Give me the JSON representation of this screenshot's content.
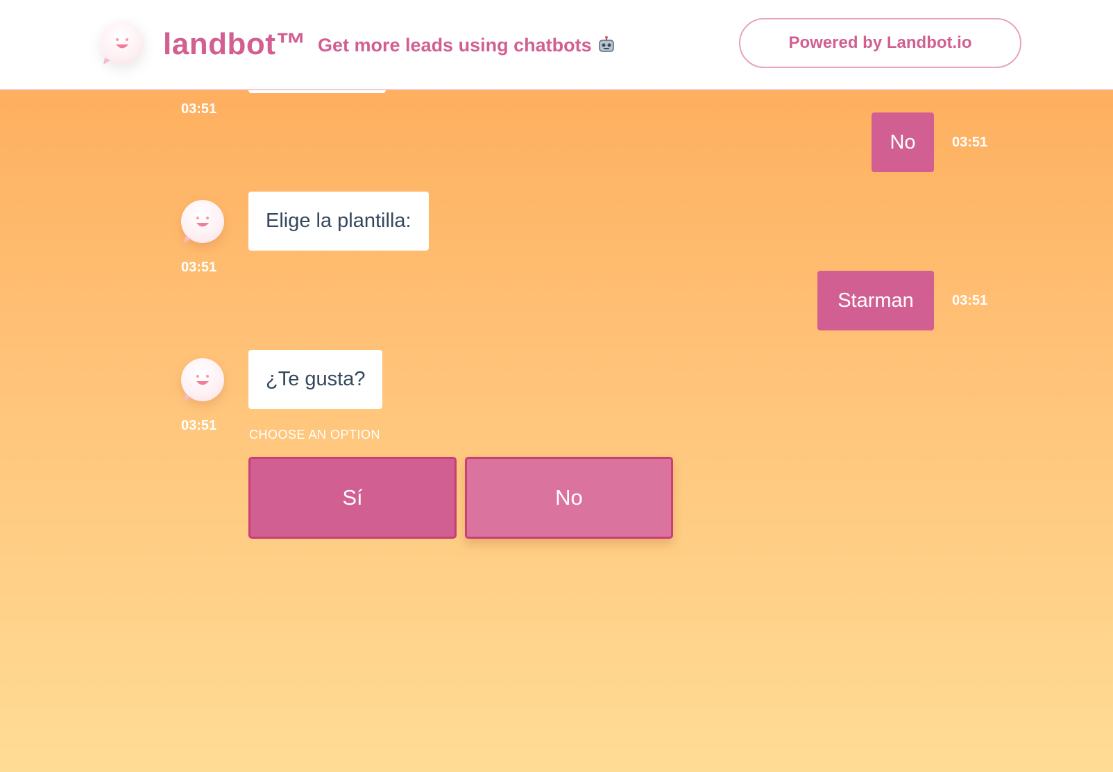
{
  "header": {
    "brand": "landbot™",
    "tagline": "Get more leads using chatbots",
    "tagline_icon": "robot-icon",
    "powered_by": "Powered by Landbot.io"
  },
  "messages": [
    {
      "from": "bot",
      "text": "",
      "time": "03:51"
    },
    {
      "from": "user",
      "text": "No",
      "time": "03:51"
    },
    {
      "from": "bot",
      "text": "Elige la plantilla:",
      "time": "03:51"
    },
    {
      "from": "user",
      "text": "Starman",
      "time": "03:51"
    },
    {
      "from": "bot",
      "text": "¿Te gusta?",
      "time": "03:51"
    }
  ],
  "choose_label": "CHOOSE AN OPTION",
  "options": [
    "Sí",
    "No"
  ],
  "colors": {
    "brand": "#d15f92",
    "background_top": "#fea957",
    "background_bottom": "#ffdc95",
    "bot_bubble": "#ffffff",
    "user_bubble": "#d15f92"
  }
}
